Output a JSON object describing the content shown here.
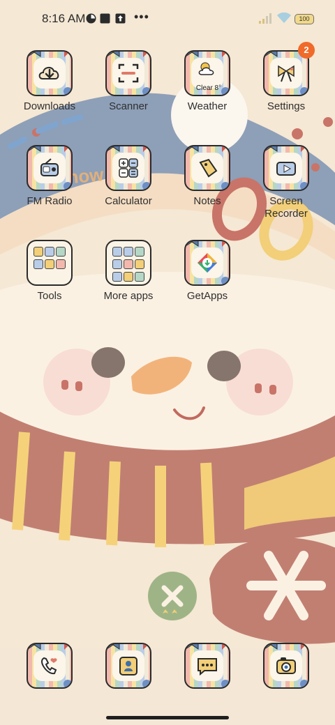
{
  "status_bar": {
    "time": "8:16 AM",
    "battery": "100",
    "icons": [
      "app-notification-icon",
      "square-notification-icon",
      "upload-icon",
      "signal-icon",
      "wifi-icon",
      "battery-icon"
    ]
  },
  "apps_row1": [
    {
      "label": "Downloads",
      "icon": "download-cloud-icon"
    },
    {
      "label": "Scanner",
      "icon": "scan-icon"
    },
    {
      "label": "Weather",
      "icon": "weather-icon",
      "sub": "Clear 8°"
    },
    {
      "label": "Settings",
      "icon": "bow-icon",
      "badge": "2"
    }
  ],
  "apps_row2": [
    {
      "label": "FM Radio",
      "icon": "radio-icon"
    },
    {
      "label": "Calculator",
      "icon": "calculator-icon"
    },
    {
      "label": "Notes",
      "icon": "tag-icon"
    },
    {
      "label": "Screen Recorder",
      "icon": "video-icon"
    }
  ],
  "apps_row3": [
    {
      "label": "Tools",
      "icon": "folder-icon"
    },
    {
      "label": "More apps",
      "icon": "folder-icon"
    },
    {
      "label": "GetApps",
      "icon": "getapps-icon"
    }
  ],
  "dock": [
    {
      "icon": "phone-icon"
    },
    {
      "icon": "contacts-icon"
    },
    {
      "icon": "messages-icon"
    },
    {
      "icon": "camera-icon"
    }
  ],
  "colors": {
    "badge": "#f06a2a",
    "text": "#2f2f2f"
  }
}
